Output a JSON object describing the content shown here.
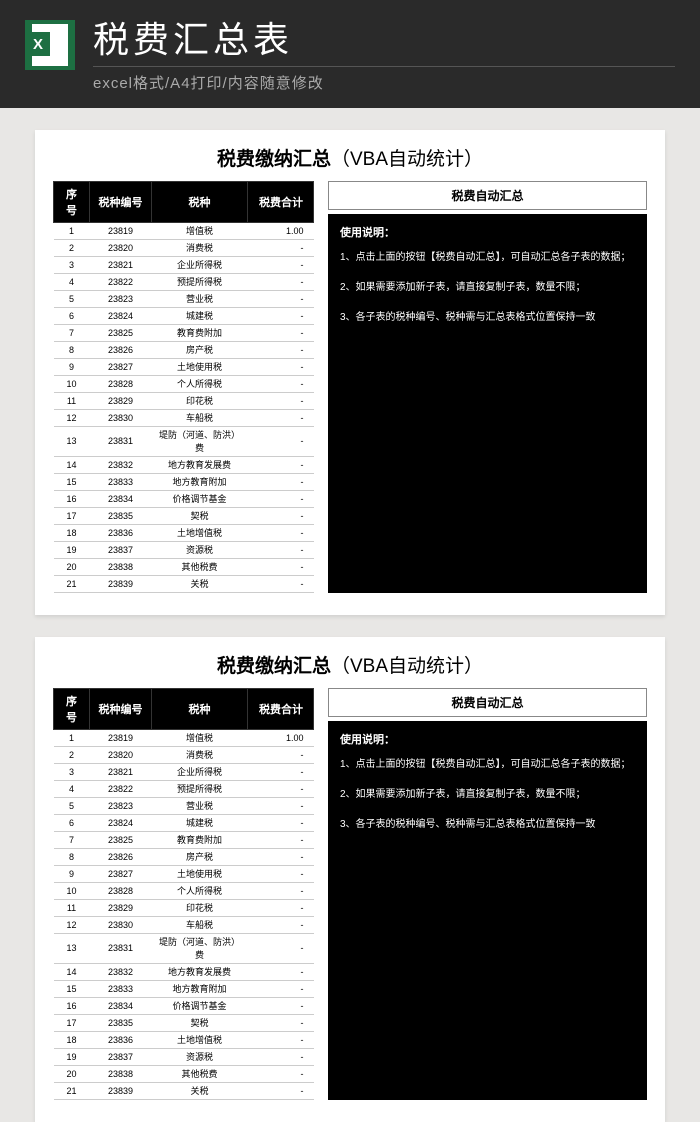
{
  "header": {
    "title": "税费汇总表",
    "subtitle": "excel格式/A4打印/内容随意修改"
  },
  "sheet": {
    "title_main": "税费缴纳汇总",
    "title_sub": "（VBA自动统计）",
    "columns": {
      "no": "序号",
      "code": "税种编号",
      "name": "税种",
      "total": "税费合计"
    },
    "rows": [
      {
        "no": "1",
        "code": "23819",
        "name": "增值税",
        "total": "1.00"
      },
      {
        "no": "2",
        "code": "23820",
        "name": "消费税",
        "total": "-"
      },
      {
        "no": "3",
        "code": "23821",
        "name": "企业所得税",
        "total": "-"
      },
      {
        "no": "4",
        "code": "23822",
        "name": "预提所得税",
        "total": "-"
      },
      {
        "no": "5",
        "code": "23823",
        "name": "营业税",
        "total": "-"
      },
      {
        "no": "6",
        "code": "23824",
        "name": "城建税",
        "total": "-"
      },
      {
        "no": "7",
        "code": "23825",
        "name": "教育费附加",
        "total": "-"
      },
      {
        "no": "8",
        "code": "23826",
        "name": "房产税",
        "total": "-"
      },
      {
        "no": "9",
        "code": "23827",
        "name": "土地使用税",
        "total": "-"
      },
      {
        "no": "10",
        "code": "23828",
        "name": "个人所得税",
        "total": "-"
      },
      {
        "no": "11",
        "code": "23829",
        "name": "印花税",
        "total": "-"
      },
      {
        "no": "12",
        "code": "23830",
        "name": "车船税",
        "total": "-"
      },
      {
        "no": "13",
        "code": "23831",
        "name": "堤防（河道、防洪）费",
        "total": "-"
      },
      {
        "no": "14",
        "code": "23832",
        "name": "地方教育发展费",
        "total": "-"
      },
      {
        "no": "15",
        "code": "23833",
        "name": "地方教育附加",
        "total": "-"
      },
      {
        "no": "16",
        "code": "23834",
        "name": "价格调节基金",
        "total": "-"
      },
      {
        "no": "17",
        "code": "23835",
        "name": "契税",
        "total": "-"
      },
      {
        "no": "18",
        "code": "23836",
        "name": "土地增值税",
        "total": "-"
      },
      {
        "no": "19",
        "code": "23837",
        "name": "资源税",
        "total": "-"
      },
      {
        "no": "20",
        "code": "23838",
        "name": "其他税费",
        "total": "-"
      },
      {
        "no": "21",
        "code": "23839",
        "name": "关税",
        "total": "-"
      }
    ],
    "side": {
      "button": "税费自动汇总",
      "inst_title": "使用说明：",
      "inst_1": "1、点击上面的按钮【税费自动汇总】，可自动汇总各子表的数据；",
      "inst_2": "2、如果需要添加新子表，请直接复制子表，数量不限；",
      "inst_3": "3、各子表的税种编号、税种需与汇总表格式位置保持一致"
    }
  }
}
